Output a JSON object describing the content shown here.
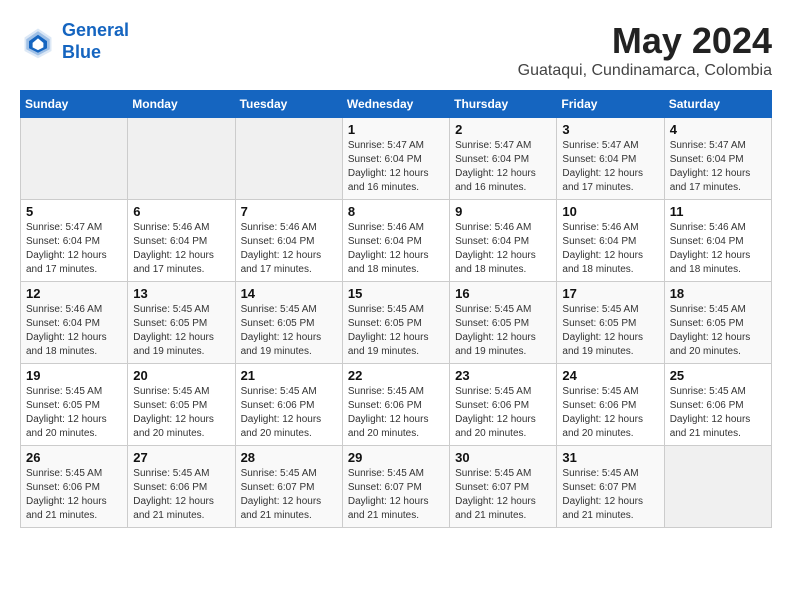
{
  "logo": {
    "line1": "General",
    "line2": "Blue"
  },
  "title": "May 2024",
  "subtitle": "Guataqui, Cundinamarca, Colombia",
  "days_of_week": [
    "Sunday",
    "Monday",
    "Tuesday",
    "Wednesday",
    "Thursday",
    "Friday",
    "Saturday"
  ],
  "weeks": [
    [
      {
        "day": "",
        "info": ""
      },
      {
        "day": "",
        "info": ""
      },
      {
        "day": "",
        "info": ""
      },
      {
        "day": "1",
        "info": "Sunrise: 5:47 AM\nSunset: 6:04 PM\nDaylight: 12 hours and 16 minutes."
      },
      {
        "day": "2",
        "info": "Sunrise: 5:47 AM\nSunset: 6:04 PM\nDaylight: 12 hours and 16 minutes."
      },
      {
        "day": "3",
        "info": "Sunrise: 5:47 AM\nSunset: 6:04 PM\nDaylight: 12 hours and 17 minutes."
      },
      {
        "day": "4",
        "info": "Sunrise: 5:47 AM\nSunset: 6:04 PM\nDaylight: 12 hours and 17 minutes."
      }
    ],
    [
      {
        "day": "5",
        "info": "Sunrise: 5:47 AM\nSunset: 6:04 PM\nDaylight: 12 hours and 17 minutes."
      },
      {
        "day": "6",
        "info": "Sunrise: 5:46 AM\nSunset: 6:04 PM\nDaylight: 12 hours and 17 minutes."
      },
      {
        "day": "7",
        "info": "Sunrise: 5:46 AM\nSunset: 6:04 PM\nDaylight: 12 hours and 17 minutes."
      },
      {
        "day": "8",
        "info": "Sunrise: 5:46 AM\nSunset: 6:04 PM\nDaylight: 12 hours and 18 minutes."
      },
      {
        "day": "9",
        "info": "Sunrise: 5:46 AM\nSunset: 6:04 PM\nDaylight: 12 hours and 18 minutes."
      },
      {
        "day": "10",
        "info": "Sunrise: 5:46 AM\nSunset: 6:04 PM\nDaylight: 12 hours and 18 minutes."
      },
      {
        "day": "11",
        "info": "Sunrise: 5:46 AM\nSunset: 6:04 PM\nDaylight: 12 hours and 18 minutes."
      }
    ],
    [
      {
        "day": "12",
        "info": "Sunrise: 5:46 AM\nSunset: 6:04 PM\nDaylight: 12 hours and 18 minutes."
      },
      {
        "day": "13",
        "info": "Sunrise: 5:45 AM\nSunset: 6:05 PM\nDaylight: 12 hours and 19 minutes."
      },
      {
        "day": "14",
        "info": "Sunrise: 5:45 AM\nSunset: 6:05 PM\nDaylight: 12 hours and 19 minutes."
      },
      {
        "day": "15",
        "info": "Sunrise: 5:45 AM\nSunset: 6:05 PM\nDaylight: 12 hours and 19 minutes."
      },
      {
        "day": "16",
        "info": "Sunrise: 5:45 AM\nSunset: 6:05 PM\nDaylight: 12 hours and 19 minutes."
      },
      {
        "day": "17",
        "info": "Sunrise: 5:45 AM\nSunset: 6:05 PM\nDaylight: 12 hours and 19 minutes."
      },
      {
        "day": "18",
        "info": "Sunrise: 5:45 AM\nSunset: 6:05 PM\nDaylight: 12 hours and 20 minutes."
      }
    ],
    [
      {
        "day": "19",
        "info": "Sunrise: 5:45 AM\nSunset: 6:05 PM\nDaylight: 12 hours and 20 minutes."
      },
      {
        "day": "20",
        "info": "Sunrise: 5:45 AM\nSunset: 6:05 PM\nDaylight: 12 hours and 20 minutes."
      },
      {
        "day": "21",
        "info": "Sunrise: 5:45 AM\nSunset: 6:06 PM\nDaylight: 12 hours and 20 minutes."
      },
      {
        "day": "22",
        "info": "Sunrise: 5:45 AM\nSunset: 6:06 PM\nDaylight: 12 hours and 20 minutes."
      },
      {
        "day": "23",
        "info": "Sunrise: 5:45 AM\nSunset: 6:06 PM\nDaylight: 12 hours and 20 minutes."
      },
      {
        "day": "24",
        "info": "Sunrise: 5:45 AM\nSunset: 6:06 PM\nDaylight: 12 hours and 20 minutes."
      },
      {
        "day": "25",
        "info": "Sunrise: 5:45 AM\nSunset: 6:06 PM\nDaylight: 12 hours and 21 minutes."
      }
    ],
    [
      {
        "day": "26",
        "info": "Sunrise: 5:45 AM\nSunset: 6:06 PM\nDaylight: 12 hours and 21 minutes."
      },
      {
        "day": "27",
        "info": "Sunrise: 5:45 AM\nSunset: 6:06 PM\nDaylight: 12 hours and 21 minutes."
      },
      {
        "day": "28",
        "info": "Sunrise: 5:45 AM\nSunset: 6:07 PM\nDaylight: 12 hours and 21 minutes."
      },
      {
        "day": "29",
        "info": "Sunrise: 5:45 AM\nSunset: 6:07 PM\nDaylight: 12 hours and 21 minutes."
      },
      {
        "day": "30",
        "info": "Sunrise: 5:45 AM\nSunset: 6:07 PM\nDaylight: 12 hours and 21 minutes."
      },
      {
        "day": "31",
        "info": "Sunrise: 5:45 AM\nSunset: 6:07 PM\nDaylight: 12 hours and 21 minutes."
      },
      {
        "day": "",
        "info": ""
      }
    ]
  ]
}
